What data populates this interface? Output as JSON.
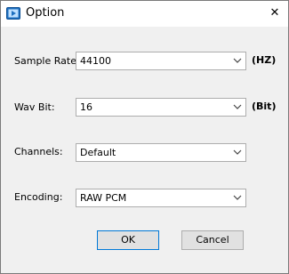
{
  "window": {
    "title": "Option",
    "close_glyph": "✕",
    "app_icon": "media-app-icon",
    "accent": "#0078d7"
  },
  "form": {
    "sample_rate": {
      "label": "Sample Rate:",
      "value": "44100",
      "unit": "(HZ)"
    },
    "wav_bit": {
      "label": "Wav Bit:",
      "value": "16",
      "unit": "(Bit)"
    },
    "channels": {
      "label": "Channels:",
      "value": "Default"
    },
    "encoding": {
      "label": "Encoding:",
      "value": "RAW PCM"
    }
  },
  "buttons": {
    "ok": "OK",
    "cancel": "Cancel"
  }
}
